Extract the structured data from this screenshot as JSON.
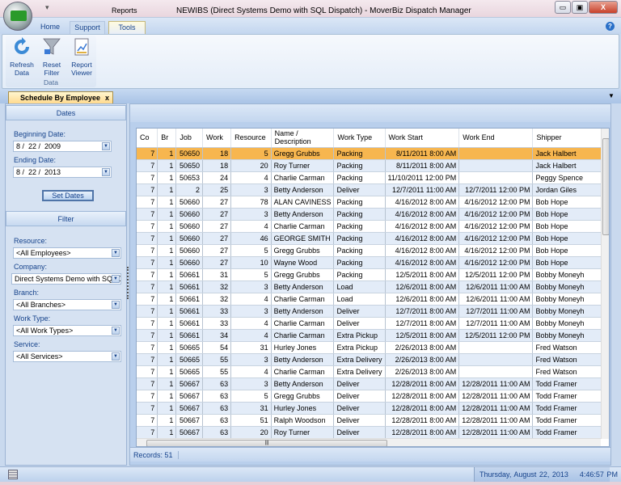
{
  "window": {
    "title": "NEWIBS (Direct Systems Demo with SQL Dispatch) - MoverBiz Dispatch Manager",
    "context_tab": "Reports",
    "minimize": "▭",
    "maximize": "▣",
    "close": "X"
  },
  "ribbon": {
    "tabs": [
      {
        "label": "Home"
      },
      {
        "label": "Support"
      },
      {
        "label": "Tools",
        "active": true
      }
    ],
    "group": {
      "label": "Data",
      "buttons": [
        {
          "label": "Refresh Data",
          "icon": "refresh-icon"
        },
        {
          "label": "Reset Filter",
          "icon": "funnel-icon"
        },
        {
          "label": "Report Viewer",
          "icon": "report-icon"
        }
      ]
    },
    "help": "?"
  },
  "doc_tab": {
    "label": "Schedule By Employee",
    "close": "x"
  },
  "left_panel": {
    "dates_header": "Dates",
    "beginning_label": "Beginning Date:",
    "beginning_value": "8 /  22 /  2009",
    "ending_label": "Ending Date:",
    "ending_value": "8 /  22 /  2013",
    "set_dates": "Set Dates",
    "filter_header": "Filter",
    "filters": [
      {
        "label": "Resource:",
        "value": "<All Employees>"
      },
      {
        "label": "Company:",
        "value": "Direct Systems Demo with SQL D"
      },
      {
        "label": "Branch:",
        "value": "<All Branches>"
      },
      {
        "label": "Work Type:",
        "value": "<All Work Types>"
      },
      {
        "label": "Service:",
        "value": "<All Services>"
      }
    ]
  },
  "grid": {
    "columns": [
      "Co",
      "Br",
      "Job",
      "Work",
      "Resource",
      "Name / Description",
      "Work Type",
      "Work Start",
      "Work End",
      "Shipper"
    ],
    "rows": [
      [
        "7",
        "1",
        "50650",
        "18",
        "5",
        "Gregg Grubbs",
        "Packing",
        "8/11/2011 8:00 AM",
        "",
        "Jack Halbert"
      ],
      [
        "7",
        "1",
        "50650",
        "18",
        "20",
        "Roy Turner",
        "Packing",
        "8/11/2011 8:00 AM",
        "",
        "Jack Halbert"
      ],
      [
        "7",
        "1",
        "50653",
        "24",
        "4",
        "Charlie Carman",
        "Packing",
        "11/10/2011 12:00 PM",
        "",
        "Peggy Spence"
      ],
      [
        "7",
        "1",
        "2",
        "25",
        "3",
        "Betty Anderson",
        "Deliver",
        "12/7/2011 11:00 AM",
        "12/7/2011 12:00 PM",
        "Jordan Giles"
      ],
      [
        "7",
        "1",
        "50660",
        "27",
        "78",
        "ALAN CAVINESS",
        "Packing",
        "4/16/2012 8:00 AM",
        "4/16/2012 12:00 PM",
        "Bob Hope"
      ],
      [
        "7",
        "1",
        "50660",
        "27",
        "3",
        "Betty Anderson",
        "Packing",
        "4/16/2012 8:00 AM",
        "4/16/2012 12:00 PM",
        "Bob Hope"
      ],
      [
        "7",
        "1",
        "50660",
        "27",
        "4",
        "Charlie Carman",
        "Packing",
        "4/16/2012 8:00 AM",
        "4/16/2012 12:00 PM",
        "Bob Hope"
      ],
      [
        "7",
        "1",
        "50660",
        "27",
        "46",
        "GEORGE SMITH",
        "Packing",
        "4/16/2012 8:00 AM",
        "4/16/2012 12:00 PM",
        "Bob Hope"
      ],
      [
        "7",
        "1",
        "50660",
        "27",
        "5",
        "Gregg Grubbs",
        "Packing",
        "4/16/2012 8:00 AM",
        "4/16/2012 12:00 PM",
        "Bob Hope"
      ],
      [
        "7",
        "1",
        "50660",
        "27",
        "10",
        "Wayne Wood",
        "Packing",
        "4/16/2012 8:00 AM",
        "4/16/2012 12:00 PM",
        "Bob Hope"
      ],
      [
        "7",
        "1",
        "50661",
        "31",
        "5",
        "Gregg Grubbs",
        "Packing",
        "12/5/2011 8:00 AM",
        "12/5/2011 12:00 PM",
        "Bobby Moneyh"
      ],
      [
        "7",
        "1",
        "50661",
        "32",
        "3",
        "Betty Anderson",
        "Load",
        "12/6/2011 8:00 AM",
        "12/6/2011 11:00 AM",
        "Bobby Moneyh"
      ],
      [
        "7",
        "1",
        "50661",
        "32",
        "4",
        "Charlie Carman",
        "Load",
        "12/6/2011 8:00 AM",
        "12/6/2011 11:00 AM",
        "Bobby Moneyh"
      ],
      [
        "7",
        "1",
        "50661",
        "33",
        "3",
        "Betty Anderson",
        "Deliver",
        "12/7/2011 8:00 AM",
        "12/7/2011 11:00 AM",
        "Bobby Moneyh"
      ],
      [
        "7",
        "1",
        "50661",
        "33",
        "4",
        "Charlie Carman",
        "Deliver",
        "12/7/2011 8:00 AM",
        "12/7/2011 11:00 AM",
        "Bobby Moneyh"
      ],
      [
        "7",
        "1",
        "50661",
        "34",
        "4",
        "Charlie Carman",
        "Extra Pickup",
        "12/5/2011 8:00 AM",
        "12/5/2011 12:00 PM",
        "Bobby Moneyh"
      ],
      [
        "7",
        "1",
        "50665",
        "54",
        "31",
        "Hurley Jones",
        "Extra Pickup",
        "2/26/2013 8:00 AM",
        "",
        "Fred Watson"
      ],
      [
        "7",
        "1",
        "50665",
        "55",
        "3",
        "Betty Anderson",
        "Extra Delivery",
        "2/26/2013 8:00 AM",
        "",
        "Fred Watson"
      ],
      [
        "7",
        "1",
        "50665",
        "55",
        "4",
        "Charlie Carman",
        "Extra Delivery",
        "2/26/2013 8:00 AM",
        "",
        "Fred Watson"
      ],
      [
        "7",
        "1",
        "50667",
        "63",
        "3",
        "Betty Anderson",
        "Deliver",
        "12/28/2011 8:00 AM",
        "12/28/2011 11:00 AM",
        "Todd Framer"
      ],
      [
        "7",
        "1",
        "50667",
        "63",
        "5",
        "Gregg Grubbs",
        "Deliver",
        "12/28/2011 8:00 AM",
        "12/28/2011 11:00 AM",
        "Todd Framer"
      ],
      [
        "7",
        "1",
        "50667",
        "63",
        "31",
        "Hurley Jones",
        "Deliver",
        "12/28/2011 8:00 AM",
        "12/28/2011 11:00 AM",
        "Todd Framer"
      ],
      [
        "7",
        "1",
        "50667",
        "63",
        "51",
        "Ralph Woodson",
        "Deliver",
        "12/28/2011 8:00 AM",
        "12/28/2011 11:00 AM",
        "Todd Framer"
      ],
      [
        "7",
        "1",
        "50667",
        "63",
        "20",
        "Roy Turner",
        "Deliver",
        "12/28/2011 8:00 AM",
        "12/28/2011 11:00 AM",
        "Todd Framer"
      ]
    ],
    "selected_row": 0,
    "selected_color": "#f7b64f",
    "alt_row_color": "#e3ecf8"
  },
  "records": "Records: 51",
  "status": {
    "datetime": "Thursday, August 22, 2013    4:46:57 PM"
  }
}
